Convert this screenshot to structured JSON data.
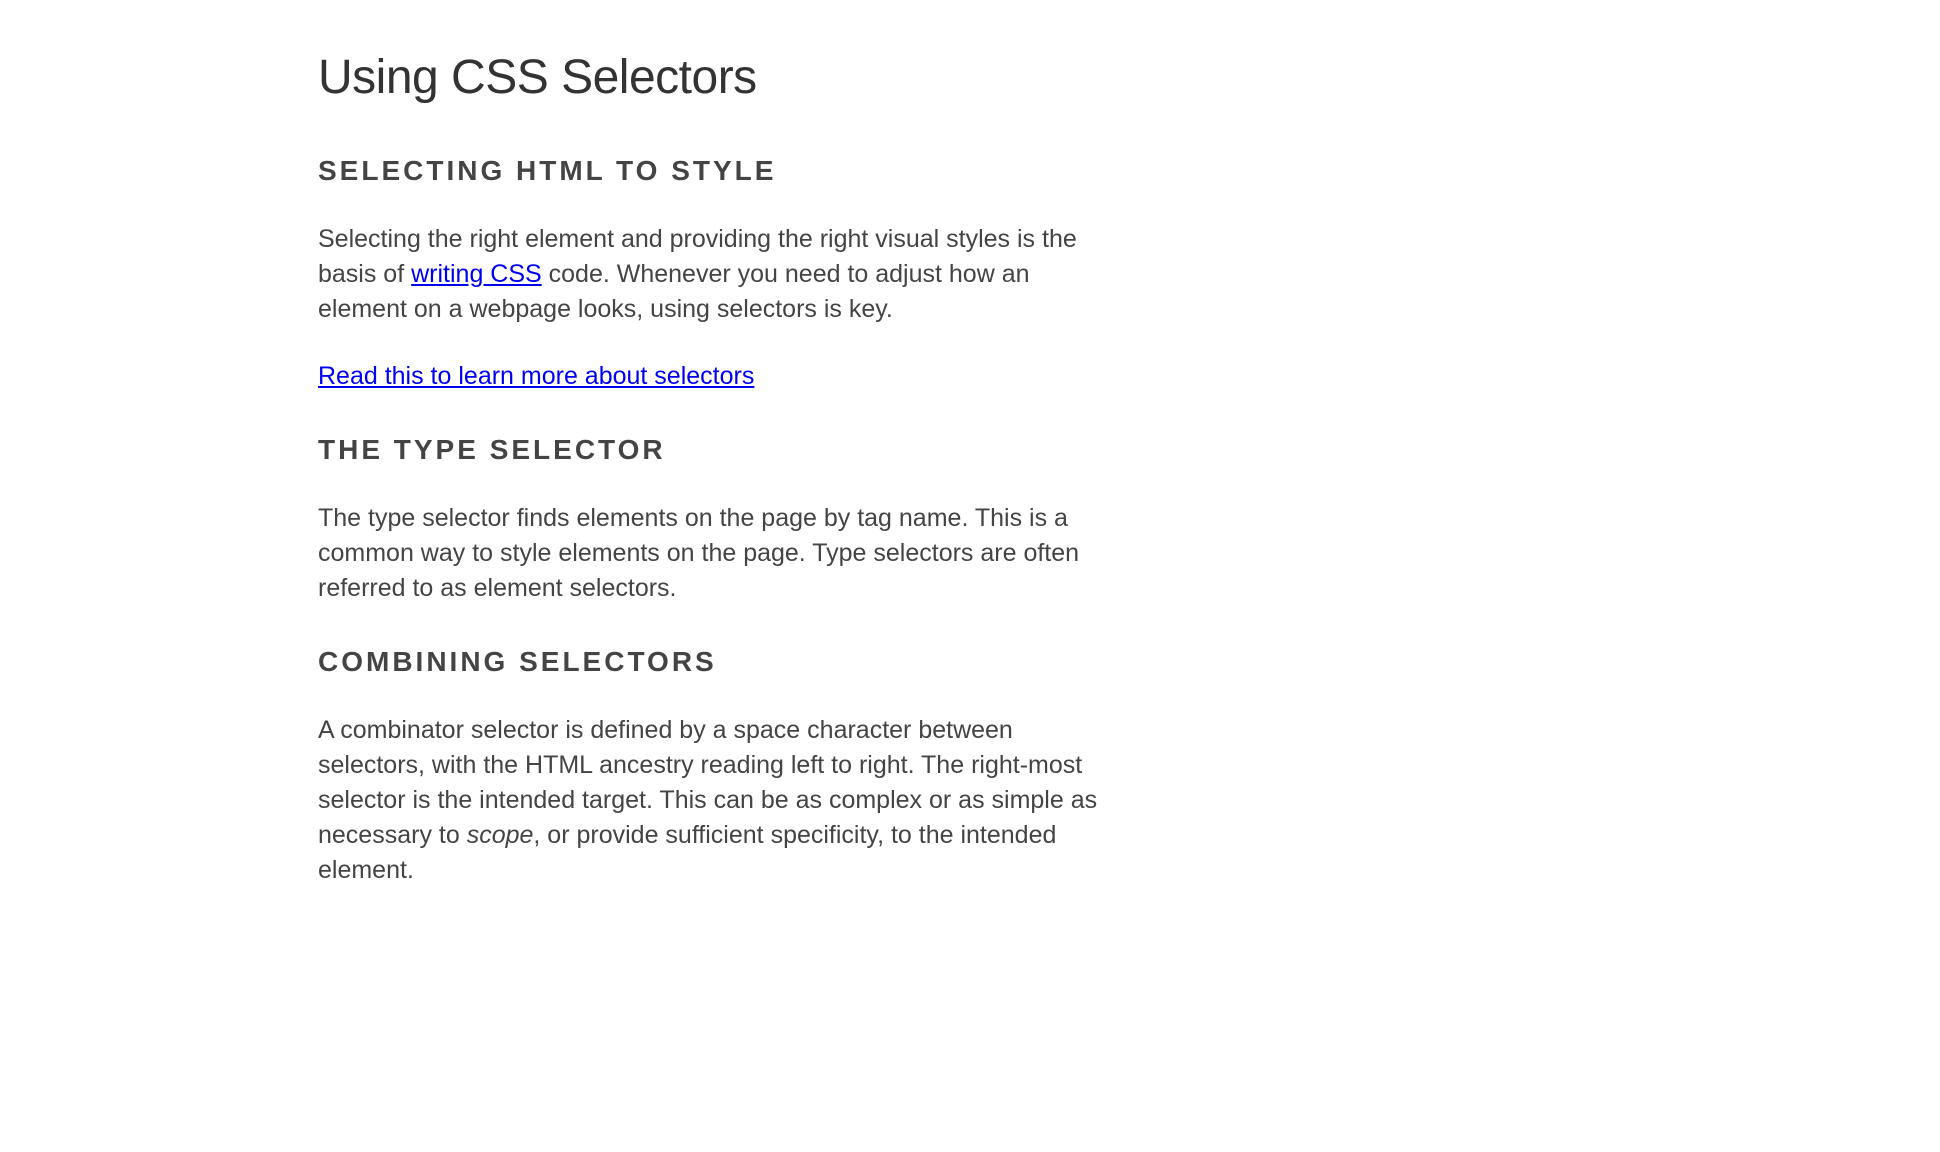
{
  "title": "Using CSS Selectors",
  "sections": [
    {
      "heading": "SELECTING HTML TO STYLE",
      "paragraph_before_link": "Selecting the right element and providing the right visual styles is the basis of ",
      "inline_link_text": "writing CSS",
      "paragraph_after_link": " code. Whenever you need to adjust how an element on a webpage looks, using selectors is key.",
      "standalone_link": "Read this to learn more about selectors"
    },
    {
      "heading": "THE TYPE SELECTOR",
      "paragraph": "The type selector finds elements on the page by tag name. This is a common way to style elements on the page. Type selectors are often referred to as element selectors."
    },
    {
      "heading": "COMBINING SELECTORS",
      "paragraph_before_em": "A combinator selector is defined by a space character between selectors, with the HTML ancestry reading left to right. The right-most selector is the intended target. This can be as complex or as simple as necessary to ",
      "em_text": "scope",
      "paragraph_after_em": ", or provide sufficient specificity, to the intended element."
    }
  ]
}
